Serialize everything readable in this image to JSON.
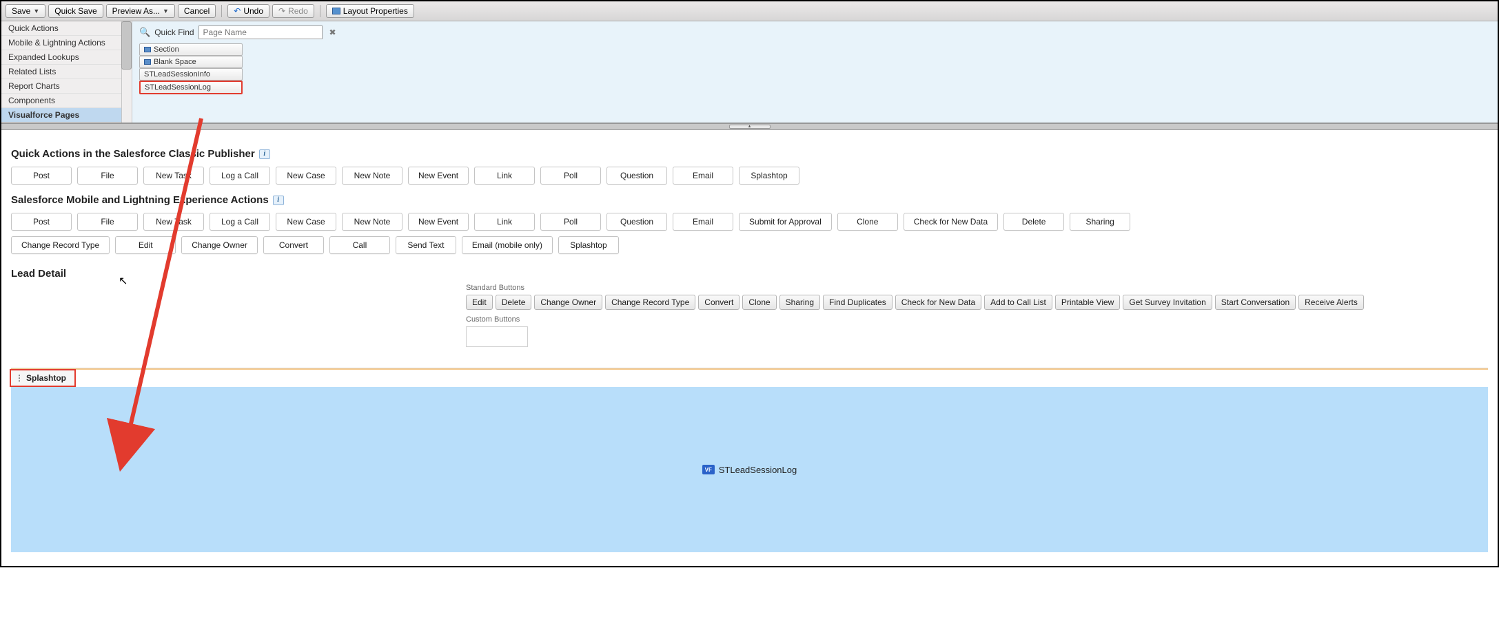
{
  "toolbar": {
    "save": "Save",
    "quick_save": "Quick Save",
    "preview_as": "Preview As...",
    "cancel": "Cancel",
    "undo": "Undo",
    "redo": "Redo",
    "layout_properties": "Layout Properties"
  },
  "palette_categories": [
    "Quick Actions",
    "Mobile & Lightning Actions",
    "Expanded Lookups",
    "Related Lists",
    "Report Charts",
    "Components",
    "Visualforce Pages"
  ],
  "selected_category_index": 6,
  "quickfind": {
    "label": "Quick Find",
    "placeholder": "Page Name",
    "value": ""
  },
  "components": [
    "Section",
    "Blank Space",
    "STLeadSessionInfo",
    "STLeadSessionLog"
  ],
  "highlight_component_index": 3,
  "sections": {
    "classic_header": "Quick Actions in the Salesforce Classic Publisher",
    "classic_actions": [
      "Post",
      "File",
      "New Task",
      "Log a Call",
      "New Case",
      "New Note",
      "New Event",
      "Link",
      "Poll",
      "Question",
      "Email",
      "Splashtop"
    ],
    "lex_header": "Salesforce Mobile and Lightning Experience Actions",
    "lex_actions_row1": [
      "Post",
      "File",
      "New Task",
      "Log a Call",
      "New Case",
      "New Note",
      "New Event",
      "Link",
      "Poll",
      "Question",
      "Email",
      "Submit for Approval",
      "Clone",
      "Check for New Data",
      "Delete",
      "Sharing"
    ],
    "lex_actions_row2": [
      "Change Record Type",
      "Edit",
      "Change Owner",
      "Convert",
      "Call",
      "Send Text",
      "Email (mobile only)",
      "Splashtop"
    ]
  },
  "lead_detail": {
    "header": "Lead Detail",
    "standard_label": "Standard Buttons",
    "standard_buttons": [
      "Edit",
      "Delete",
      "Change Owner",
      "Change Record Type",
      "Convert",
      "Clone",
      "Sharing",
      "Find Duplicates",
      "Check for New Data",
      "Add to Call List",
      "Printable View",
      "Get Survey Invitation",
      "Start Conversation",
      "Receive Alerts"
    ],
    "custom_label": "Custom Buttons"
  },
  "splashtop": {
    "tab_label": "Splashtop",
    "drop_label": "STLeadSessionLog",
    "vf_badge": "VF"
  }
}
